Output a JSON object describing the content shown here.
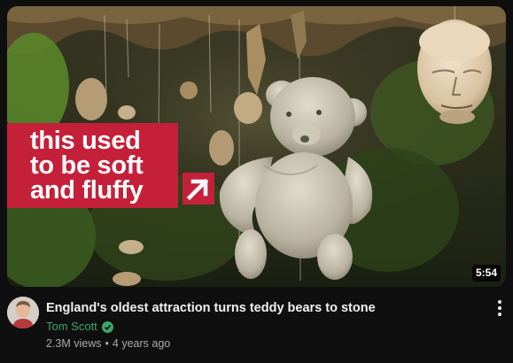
{
  "video": {
    "thumbnail_caption": [
      "this used",
      "to be soft",
      "and fluffy"
    ],
    "duration": "5:54",
    "title": "England's oldest attraction turns teddy bears to stone",
    "channel_name": "Tom Scott",
    "views": "2.3M views",
    "age": "4 years ago"
  },
  "icons": {
    "verified": "verified-check-icon",
    "menu": "more-vert-icon",
    "caption_arrow": "arrow-up-right-icon"
  },
  "colors": {
    "background": "#0f0f0f",
    "caption_box": "#c4203a",
    "channel_name": "#3ea66a",
    "title": "#f1f1f1",
    "meta_text": "#aaaaaa"
  }
}
